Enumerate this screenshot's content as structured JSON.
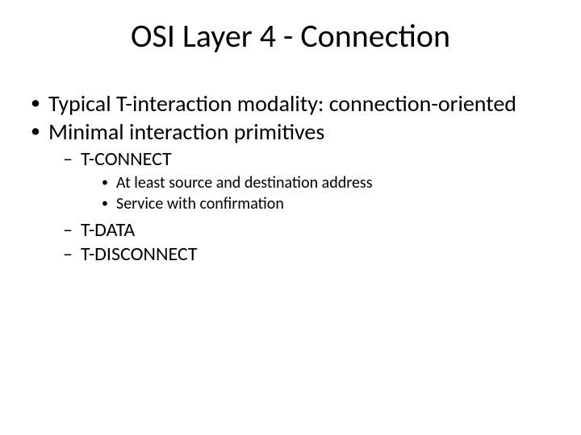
{
  "title": "OSI Layer 4 - Connection",
  "bullets": {
    "b1": "Typical T-interaction modality: connection-oriented",
    "b2": "Minimal interaction primitives",
    "b2_1": "T-CONNECT",
    "b2_1_1": "At least source and destination address",
    "b2_1_2": "Service with confirmation",
    "b2_2": "T-DATA",
    "b2_3": "T-DISCONNECT"
  }
}
